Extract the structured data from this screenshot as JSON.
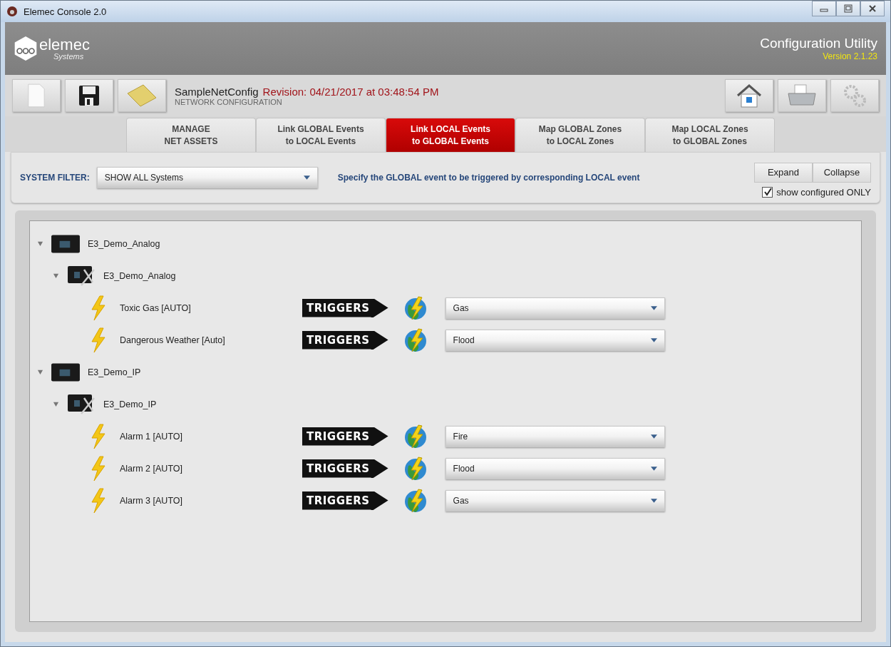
{
  "window": {
    "title": "Elemec Console 2.0"
  },
  "header": {
    "logo_text": "elemec",
    "logo_subtext": "Systems",
    "title": "Configuration Utility",
    "version": "Version 2.1.23"
  },
  "document": {
    "name": "SampleNetConfig",
    "revision": "Revision: 04/21/2017 at 03:48:54 PM",
    "subtitle": "NETWORK CONFIGURATION"
  },
  "tabs": [
    {
      "line1": "MANAGE",
      "line2": "NET ASSETS",
      "selected": false
    },
    {
      "line1": "Link GLOBAL Events",
      "line2": "to LOCAL Events",
      "selected": false
    },
    {
      "line1": "Link LOCAL Events",
      "line2": "to GLOBAL Events",
      "selected": true
    },
    {
      "line1": "Map GLOBAL Zones",
      "line2": "to LOCAL Zones",
      "selected": false
    },
    {
      "line1": "Map LOCAL Zones",
      "line2": "to GLOBAL Zones",
      "selected": false
    }
  ],
  "filter": {
    "label": "SYSTEM FILTER:",
    "value": "SHOW ALL Systems",
    "hint": "Specify the GLOBAL event to be triggered by corresponding LOCAL event"
  },
  "buttons": [
    "Expand",
    "Collapse"
  ],
  "show_configured_only": {
    "label": "show configured ONLY",
    "checked": true
  },
  "tree": [
    {
      "name": "E3_Demo_Analog",
      "expanded": true,
      "children": [
        {
          "name": "E3_Demo_Analog",
          "expanded": true,
          "children": [
            {
              "name": "Toxic Gas [AUTO]",
              "arrow": "TRIGGERS",
              "global_event": "Gas"
            },
            {
              "name": "Dangerous Weather  [Auto]",
              "arrow": "TRIGGERS",
              "global_event": "Flood"
            }
          ]
        }
      ]
    },
    {
      "name": "E3_Demo_IP",
      "expanded": true,
      "children": [
        {
          "name": "E3_Demo_IP",
          "expanded": true,
          "children": [
            {
              "name": "Alarm 1 [AUTO]",
              "arrow": "TRIGGERS",
              "global_event": "Fire"
            },
            {
              "name": "Alarm 2 [AUTO]",
              "arrow": "TRIGGERS",
              "global_event": "Flood"
            },
            {
              "name": "Alarm 3 [AUTO]",
              "arrow": "TRIGGERS",
              "global_event": "Gas"
            }
          ]
        }
      ]
    }
  ]
}
